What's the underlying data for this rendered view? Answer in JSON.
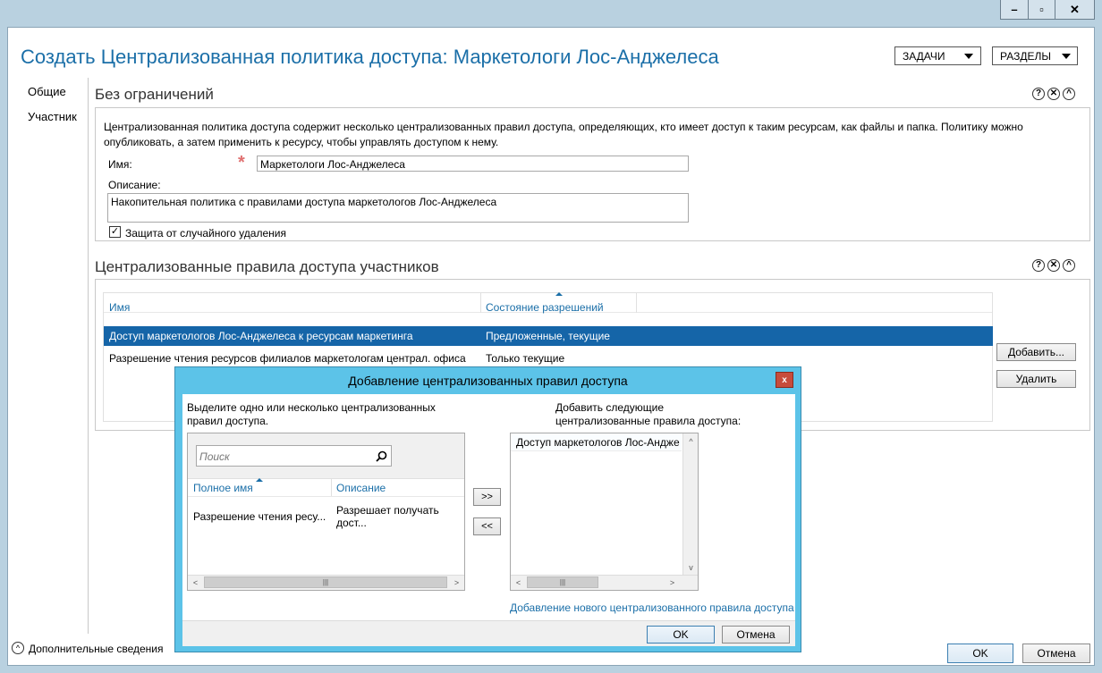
{
  "window": {
    "minimize_glyph": "–",
    "restore_glyph": "▫",
    "close_glyph": "✕"
  },
  "header": {
    "title": "Создать Централизованная политика доступа: Маркетологи Лос-Анджелеса",
    "tasks_label": "ЗАДАЧИ",
    "sections_label": "РАЗДЕЛЫ"
  },
  "nav": {
    "items": [
      {
        "label": "Общие"
      },
      {
        "label": "Участник"
      }
    ]
  },
  "general": {
    "section_title": "Без ограничений",
    "description_text": "Централизованная политика доступа содержит несколько централизованных правил доступа, определяющих, кто имеет доступ к таким ресурсам, как файлы и папка. Политику можно опубликовать, а затем применить к ресурсу, чтобы управлять доступом к нему.",
    "name_label": "Имя:",
    "name_value": "Маркетологи Лос-Анджелеса",
    "desc_label": "Описание:",
    "desc_value": "Накопительная политика с правилами доступа маркетологов Лос-Анджелеса",
    "protect_label": "Защита от случайного удаления",
    "protect_checked": true
  },
  "members": {
    "section_title": "Централизованные правила доступа участников",
    "columns": [
      "Имя",
      "Состояние разрешений"
    ],
    "rows": [
      {
        "name": "Доступ маркетологов Лос-Анджелеса к ресурсам маркетинга",
        "state": "Предложенные, текущие",
        "selected": true
      },
      {
        "name": "Разрешение чтения ресурсов филиалов маркетологам централ. офиса",
        "state": "Только текущие",
        "selected": false
      }
    ],
    "add_button": "Добавить...",
    "remove_button": "Удалить"
  },
  "dialog": {
    "title": "Добавление централизованных правил доступа",
    "close_glyph": "x",
    "left_hint": "Выделите одно или несколько централизованных правил доступа.",
    "search_placeholder": "Поиск",
    "left_columns": [
      "Полное имя",
      "Описание"
    ],
    "left_rows": [
      {
        "name": "Разрешение чтения ресу...",
        "desc": "Разрешает получать дост..."
      }
    ],
    "add_arrow": ">>",
    "remove_arrow": "<<",
    "right_hint": "Добавить следующие централизованные правила доступа:",
    "right_items": [
      "Доступ маркетологов Лос-Андже"
    ],
    "new_rule_link": "Добавление нового централизованного правила доступа",
    "ok_label": "OK",
    "cancel_label": "Отмена"
  },
  "footer": {
    "more_info": "Дополнительные сведения",
    "ok_label": "OK",
    "cancel_label": "Отмена"
  }
}
